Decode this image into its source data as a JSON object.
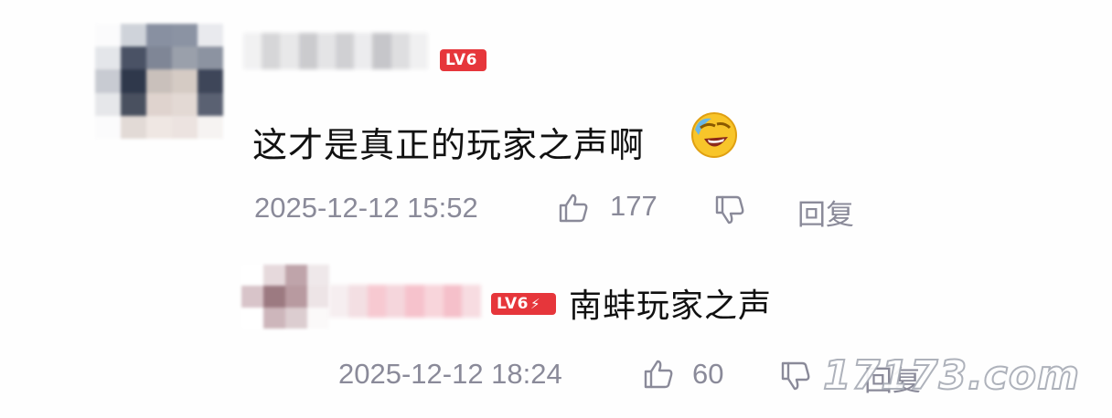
{
  "comment": {
    "level_badge": "LV6",
    "text": "这才是真正的玩家之声啊",
    "emoji_icon": "laughing-crying-face-icon",
    "timestamp": "2025-12-12 15:52",
    "like_count": "177",
    "reply_label": "回复"
  },
  "reply": {
    "level_badge": "LV6",
    "text": "南蚌玩家之声",
    "timestamp": "2025-12-12 18:24",
    "like_count": "60",
    "reply_label": "回复"
  },
  "watermark": "17173.com",
  "colors": {
    "badge": "#e6363b",
    "meta_text": "#8a8a99",
    "body_text": "#111111"
  }
}
